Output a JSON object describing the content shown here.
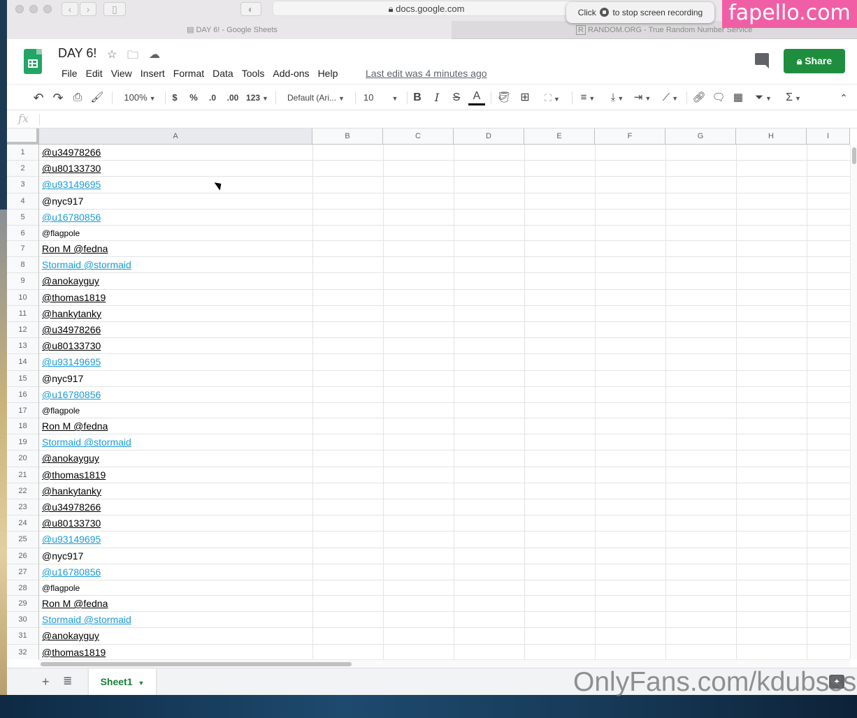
{
  "browser": {
    "url": "docs.google.com",
    "tabs": [
      {
        "label": "DAY 6! - Google Sheets",
        "active": true
      },
      {
        "label": "RANDOM.ORG - True Random Number Service",
        "active": false
      }
    ],
    "recording_hint_prefix": "Click",
    "recording_hint_suffix": "to stop screen recording"
  },
  "watermarks": {
    "top": "fapello.com",
    "bottom": "OnlyFans.com/kdubsss"
  },
  "doc": {
    "title": "DAY 6!",
    "last_edit": "Last edit was 4 minutes ago",
    "share_label": "Share"
  },
  "menu": [
    "File",
    "Edit",
    "View",
    "Insert",
    "Format",
    "Data",
    "Tools",
    "Add-ons",
    "Help"
  ],
  "toolbar": {
    "zoom": "100%",
    "currency": "$",
    "percent": "%",
    "dec_decrease": ".0",
    "dec_increase": ".00",
    "format_more": "123",
    "font": "Default (Ari...",
    "font_size": "10",
    "bold": "B",
    "italic": "I",
    "strike": "S",
    "text_color": "A",
    "sigma": "Σ"
  },
  "formula_bar": {
    "fx": "fx",
    "value": ""
  },
  "columns": [
    "A",
    "B",
    "C",
    "D",
    "E",
    "F",
    "G",
    "H",
    "I"
  ],
  "rows": [
    {
      "n": "1",
      "a": "@u34978266",
      "style": "normal"
    },
    {
      "n": "2",
      "a": "@u80133730",
      "style": "normal"
    },
    {
      "n": "3",
      "a": "@u93149695",
      "style": "link"
    },
    {
      "n": "4",
      "a": "@nyc917",
      "style": "plain"
    },
    {
      "n": "5",
      "a": "@u16780856",
      "style": "link"
    },
    {
      "n": "6",
      "a": "@flagpole",
      "style": "small"
    },
    {
      "n": "7",
      "a": "Ron M @fedna",
      "style": "normal"
    },
    {
      "n": "8",
      "a": "Stormaid @stormaid",
      "style": "link"
    },
    {
      "n": "9",
      "a": "@anokayguy",
      "style": "normal"
    },
    {
      "n": "10",
      "a": "@thomas1819",
      "style": "normal"
    },
    {
      "n": "11",
      "a": "@hankytanky",
      "style": "normal"
    },
    {
      "n": "12",
      "a": "@u34978266",
      "style": "normal"
    },
    {
      "n": "13",
      "a": "@u80133730",
      "style": "normal"
    },
    {
      "n": "14",
      "a": "@u93149695",
      "style": "link"
    },
    {
      "n": "15",
      "a": "@nyc917",
      "style": "plain"
    },
    {
      "n": "16",
      "a": "@u16780856",
      "style": "link"
    },
    {
      "n": "17",
      "a": "@flagpole",
      "style": "small"
    },
    {
      "n": "18",
      "a": "Ron M @fedna",
      "style": "normal"
    },
    {
      "n": "19",
      "a": "Stormaid @stormaid",
      "style": "link"
    },
    {
      "n": "20",
      "a": "@anokayguy",
      "style": "normal"
    },
    {
      "n": "21",
      "a": "@thomas1819",
      "style": "normal"
    },
    {
      "n": "22",
      "a": "@hankytanky",
      "style": "normal"
    },
    {
      "n": "23",
      "a": "@u34978266",
      "style": "normal"
    },
    {
      "n": "24",
      "a": "@u80133730",
      "style": "normal"
    },
    {
      "n": "25",
      "a": "@u93149695",
      "style": "link"
    },
    {
      "n": "26",
      "a": "@nyc917",
      "style": "plain"
    },
    {
      "n": "27",
      "a": "@u16780856",
      "style": "link"
    },
    {
      "n": "28",
      "a": "@flagpole",
      "style": "small"
    },
    {
      "n": "29",
      "a": "Ron M @fedna",
      "style": "normal"
    },
    {
      "n": "30",
      "a": "Stormaid @stormaid",
      "style": "link"
    },
    {
      "n": "31",
      "a": "@anokayguy",
      "style": "normal"
    },
    {
      "n": "32",
      "a": "@thomas1819",
      "style": "normal"
    }
  ],
  "sheets": [
    {
      "label": "Sheet1",
      "active": true
    }
  ],
  "colors": {
    "accent_green": "#1e8e3e",
    "link_blue": "#1a9bd7"
  }
}
